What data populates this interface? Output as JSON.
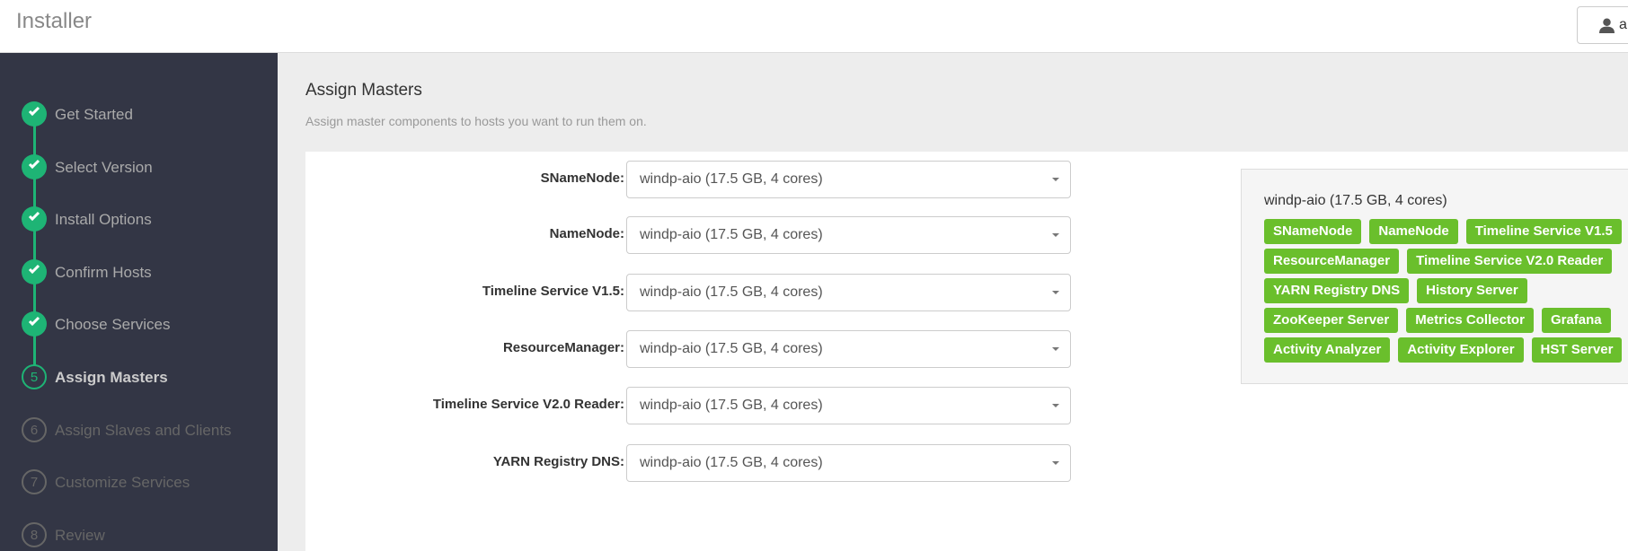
{
  "header": {
    "title": "Installer",
    "user_label": "a"
  },
  "steps": [
    {
      "label": "Get Started",
      "state": "done"
    },
    {
      "label": "Select Version",
      "state": "done"
    },
    {
      "label": "Install Options",
      "state": "done"
    },
    {
      "label": "Confirm Hosts",
      "state": "done"
    },
    {
      "label": "Choose Services",
      "state": "done"
    },
    {
      "label": "Assign Masters",
      "state": "current",
      "num": "5"
    },
    {
      "label": "Assign Slaves and Clients",
      "state": "todo",
      "num": "6"
    },
    {
      "label": "Customize Services",
      "state": "todo",
      "num": "7"
    },
    {
      "label": "Review",
      "state": "todo",
      "num": "8"
    }
  ],
  "main": {
    "title": "Assign Masters",
    "subtitle": "Assign master components to hosts you want to run them on."
  },
  "assignments": [
    {
      "label": "SNameNode:",
      "value": "windp-aio (17.5 GB, 4 cores)"
    },
    {
      "label": "NameNode:",
      "value": "windp-aio (17.5 GB, 4 cores)"
    },
    {
      "label": "Timeline Service V1.5:",
      "value": "windp-aio (17.5 GB, 4 cores)"
    },
    {
      "label": "ResourceManager:",
      "value": "windp-aio (17.5 GB, 4 cores)"
    },
    {
      "label": "Timeline Service V2.0 Reader:",
      "value": "windp-aio (17.5 GB, 4 cores)"
    },
    {
      "label": "YARN Registry DNS:",
      "value": "windp-aio (17.5 GB, 4 cores)"
    }
  ],
  "host_summary": {
    "host": "windp-aio (17.5 GB, 4 cores)",
    "tag_color": "#6abf2c",
    "tag_rows": [
      [
        "SNameNode",
        "NameNode",
        "Timeline Service V1.5"
      ],
      [
        "ResourceManager",
        "Timeline Service V2.0 Reader"
      ],
      [
        "YARN Registry DNS",
        "History Server"
      ],
      [
        "ZooKeeper Server",
        "Metrics Collector",
        "Grafana"
      ],
      [
        "Activity Analyzer",
        "Activity Explorer",
        "HST Server"
      ]
    ]
  }
}
